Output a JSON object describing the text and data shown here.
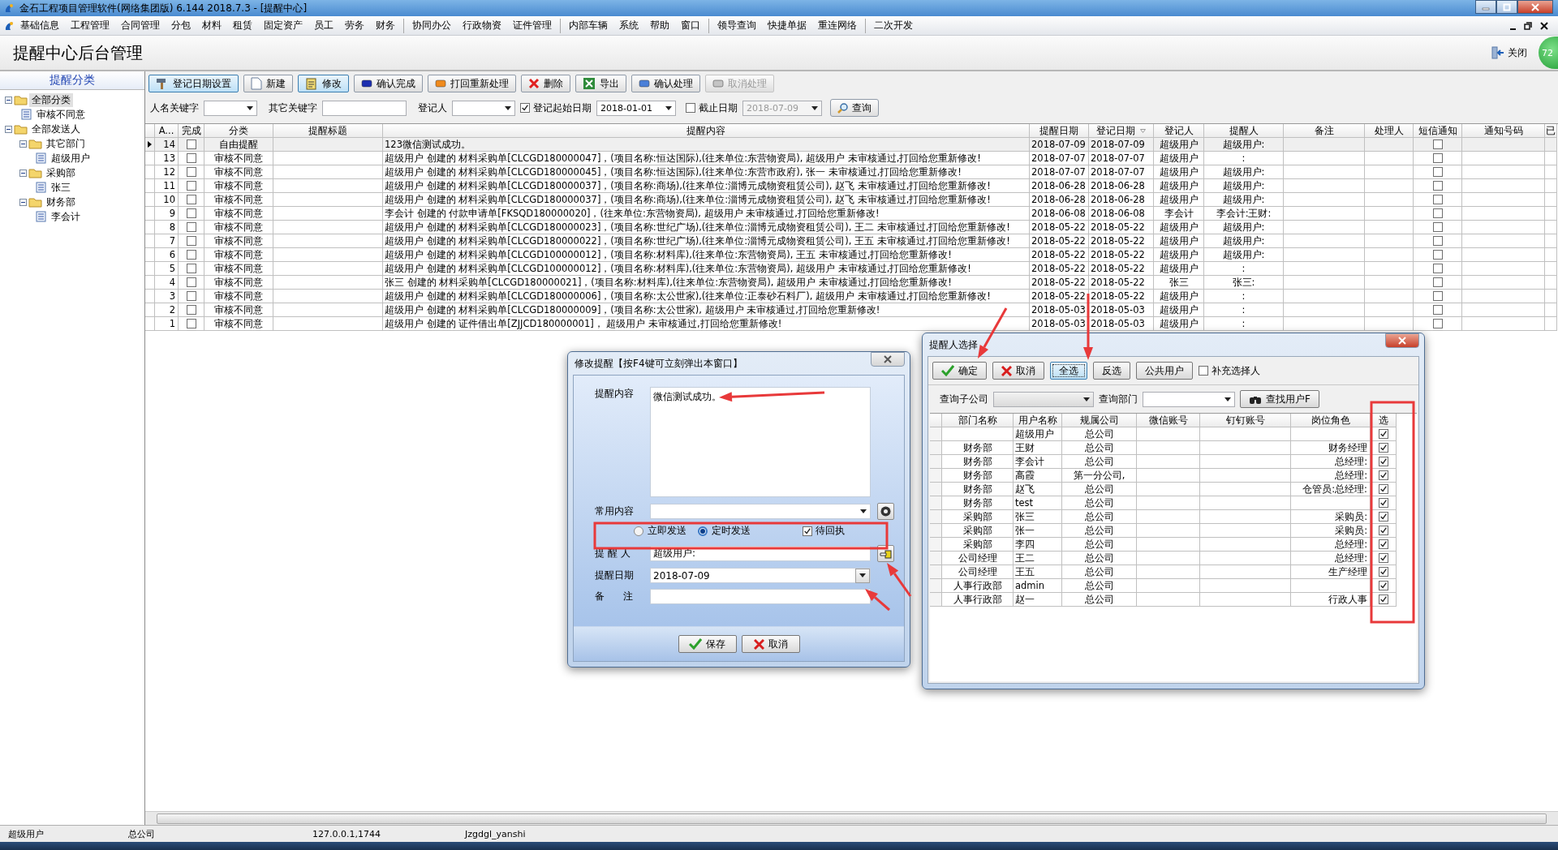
{
  "window": {
    "title": "金石工程项目管理软件(网络集团版) 6.144  2018.7.3 - [提醒中心]"
  },
  "menu_groups": [
    [
      "基础信息",
      "工程管理",
      "合同管理",
      "分包",
      "材料",
      "租赁",
      "固定资产",
      "员工",
      "劳务",
      "财务"
    ],
    [
      "协同办公",
      "行政物资",
      "证件管理"
    ],
    [
      "内部车辆",
      "系统",
      "帮助",
      "窗口"
    ],
    [
      "领导查询",
      "快捷单据",
      "重连网络"
    ],
    [
      "二次开发"
    ]
  ],
  "page": {
    "title": "提醒中心后台管理",
    "close_label": "关闭",
    "badge": "72"
  },
  "sidebar": {
    "title": "提醒分类",
    "tree": [
      {
        "label": "全部分类",
        "expanded": true,
        "selected": true,
        "children": [
          {
            "label": "审核不同意",
            "selected": false
          }
        ]
      },
      {
        "label": "全部发送人",
        "expanded": true,
        "selected": false,
        "children": [
          {
            "label": "其它部门",
            "expanded": true,
            "selected": false,
            "children": [
              {
                "label": "超级用户",
                "selected": false
              }
            ]
          },
          {
            "label": "采购部",
            "expanded": true,
            "selected": false,
            "children": [
              {
                "label": "张三",
                "selected": false
              }
            ]
          },
          {
            "label": "财务部",
            "expanded": true,
            "selected": false,
            "children": [
              {
                "label": "李会计",
                "selected": false
              }
            ]
          }
        ]
      }
    ]
  },
  "toolbar": [
    {
      "label": "登记日期设置",
      "pressed": true,
      "disabled": false
    },
    {
      "label": "新建",
      "pressed": false,
      "disabled": false
    },
    {
      "label": "修改",
      "pressed": true,
      "disabled": false
    },
    {
      "label": "确认完成",
      "pressed": false,
      "disabled": false
    },
    {
      "label": "打回重新处理",
      "pressed": false,
      "disabled": false
    },
    {
      "label": "删除",
      "pressed": false,
      "disabled": false
    },
    {
      "label": "导出",
      "pressed": false,
      "disabled": false
    },
    {
      "label": "确认处理",
      "pressed": false,
      "disabled": false
    },
    {
      "label": "取消处理",
      "pressed": false,
      "disabled": true
    }
  ],
  "filters": {
    "name_keyword": {
      "label": "人名关键字"
    },
    "other_keyword": {
      "label": "其它关键字"
    },
    "registrar": {
      "label": "登记人"
    },
    "start_date": {
      "label": "登记起始日期",
      "checked": true,
      "value": "2018-01-01"
    },
    "end_date": {
      "label": "截止日期",
      "checked": false,
      "value": "2018-07-09"
    },
    "query_button": "查询"
  },
  "table": {
    "columns": [
      {
        "label": "A...",
        "sorted": false
      },
      {
        "label": "完成",
        "sorted": false
      },
      {
        "label": "分类",
        "sorted": false
      },
      {
        "label": "提醒标题",
        "sorted": false
      },
      {
        "label": "提醒内容",
        "sorted": false
      },
      {
        "label": "提醒日期",
        "sorted": false
      },
      {
        "label": "登记日期",
        "sorted": true
      },
      {
        "label": "登记人",
        "sorted": false
      },
      {
        "label": "提醒人",
        "sorted": false
      },
      {
        "label": "备注",
        "sorted": false
      },
      {
        "label": "处理人",
        "sorted": false
      },
      {
        "label": "短信通知",
        "sorted": false
      },
      {
        "label": "通知号码",
        "sorted": false
      },
      {
        "label": "已",
        "sorted": false
      }
    ],
    "rows": [
      {
        "current": true,
        "no": "14",
        "done": false,
        "category": "自由提醒",
        "content": "123微信测试成功。",
        "remind_date": "2018-07-09",
        "register_date": "2018-07-09",
        "registrar": "超级用户",
        "reminder": "超级用户:",
        "sms": false
      },
      {
        "current": false,
        "no": "13",
        "done": false,
        "category": "审核不同意",
        "content": "超级用户 创建的 材料采购单[CLCGD180000047]，(项目名称:恒达国际),(往来单位:东营物资局), 超级用户 未审核通过,打回给您重新修改!",
        "remind_date": "2018-07-07",
        "register_date": "2018-07-07",
        "registrar": "超级用户",
        "reminder": ":",
        "sms": false
      },
      {
        "current": false,
        "no": "12",
        "done": false,
        "category": "审核不同意",
        "content": "超级用户 创建的 材料采购单[CLCGD180000045]，(项目名称:恒达国际),(往来单位:东营市政府), 张一 未审核通过,打回给您重新修改!",
        "remind_date": "2018-07-07",
        "register_date": "2018-07-07",
        "registrar": "超级用户",
        "reminder": "超级用户:",
        "sms": false
      },
      {
        "current": false,
        "no": "11",
        "done": false,
        "category": "审核不同意",
        "content": "超级用户 创建的 材料采购单[CLCGD180000037]，(项目名称:商场),(往来单位:淄博元成物资租赁公司), 赵飞 未审核通过,打回给您重新修改!",
        "remind_date": "2018-06-28",
        "register_date": "2018-06-28",
        "registrar": "超级用户",
        "reminder": "超级用户:",
        "sms": false
      },
      {
        "current": false,
        "no": "10",
        "done": false,
        "category": "审核不同意",
        "content": "超级用户 创建的 材料采购单[CLCGD180000037]，(项目名称:商场),(往来单位:淄博元成物资租赁公司), 赵飞 未审核通过,打回给您重新修改!",
        "remind_date": "2018-06-28",
        "register_date": "2018-06-28",
        "registrar": "超级用户",
        "reminder": "超级用户:",
        "sms": false
      },
      {
        "current": false,
        "no": "9",
        "done": false,
        "category": "审核不同意",
        "content": "李会计 创建的 付款申请单[FKSQD180000020]，(往来单位:东营物资局), 超级用户 未审核通过,打回给您重新修改!",
        "remind_date": "2018-06-08",
        "register_date": "2018-06-08",
        "registrar": "李会计",
        "reminder": "李会计:王财:",
        "sms": false
      },
      {
        "current": false,
        "no": "8",
        "done": false,
        "category": "审核不同意",
        "content": "超级用户 创建的 材料采购单[CLCGD180000023]，(项目名称:世纪广场),(往来单位:淄博元成物资租赁公司), 王二 未审核通过,打回给您重新修改!",
        "remind_date": "2018-05-22",
        "register_date": "2018-05-22",
        "registrar": "超级用户",
        "reminder": "超级用户:",
        "sms": false
      },
      {
        "current": false,
        "no": "7",
        "done": false,
        "category": "审核不同意",
        "content": "超级用户 创建的 材料采购单[CLCGD180000022]，(项目名称:世纪广场),(往来单位:淄博元成物资租赁公司), 王五 未审核通过,打回给您重新修改!",
        "remind_date": "2018-05-22",
        "register_date": "2018-05-22",
        "registrar": "超级用户",
        "reminder": "超级用户:",
        "sms": false
      },
      {
        "current": false,
        "no": "6",
        "done": false,
        "category": "审核不同意",
        "content": "超级用户 创建的 材料采购单[CLCGD100000012]，(项目名称:材料库),(往来单位:东营物资局), 王五 未审核通过,打回给您重新修改!",
        "remind_date": "2018-05-22",
        "register_date": "2018-05-22",
        "registrar": "超级用户",
        "reminder": "超级用户:",
        "sms": false
      },
      {
        "current": false,
        "no": "5",
        "done": false,
        "category": "审核不同意",
        "content": "超级用户 创建的 材料采购单[CLCGD100000012]，(项目名称:材料库),(往来单位:东营物资局), 超级用户 未审核通过,打回给您重新修改!",
        "remind_date": "2018-05-22",
        "register_date": "2018-05-22",
        "registrar": "超级用户",
        "reminder": ":",
        "sms": false
      },
      {
        "current": false,
        "no": "4",
        "done": false,
        "category": "审核不同意",
        "content": "张三 创建的 材料采购单[CLCGD180000021]，(项目名称:材料库),(往来单位:东营物资局), 超级用户 未审核通过,打回给您重新修改!",
        "remind_date": "2018-05-22",
        "register_date": "2018-05-22",
        "registrar": "张三",
        "reminder": "张三:",
        "sms": false
      },
      {
        "current": false,
        "no": "3",
        "done": false,
        "category": "审核不同意",
        "content": "超级用户 创建的 材料采购单[CLCGD180000006]，(项目名称:太公世家),(往来单位:正泰砂石料厂), 超级用户 未审核通过,打回给您重新修改!",
        "remind_date": "2018-05-22",
        "register_date": "2018-05-22",
        "registrar": "超级用户",
        "reminder": ":",
        "sms": false
      },
      {
        "current": false,
        "no": "2",
        "done": false,
        "category": "审核不同意",
        "content": "超级用户 创建的 材料采购单[CLCGD180000009]，(项目名称:太公世家), 超级用户 未审核通过,打回给您重新修改!",
        "remind_date": "2018-05-03",
        "register_date": "2018-05-03",
        "registrar": "超级用户",
        "reminder": ":",
        "sms": false
      },
      {
        "current": false,
        "no": "1",
        "done": false,
        "category": "审核不同意",
        "content": "超级用户 创建的 证件借出单[ZJJCD180000001]， 超级用户 未审核通过,打回给您重新修改!",
        "remind_date": "2018-05-03",
        "register_date": "2018-05-03",
        "registrar": "超级用户",
        "reminder": ":",
        "sms": false
      }
    ]
  },
  "edit_dialog": {
    "title": "修改提醒【按F4键可立刻弹出本窗口】",
    "content": {
      "label": "提醒内容",
      "value": "微信测试成功。"
    },
    "common": {
      "label": "常用内容"
    },
    "send_modes": [
      {
        "label": "立即发送",
        "selected": false
      },
      {
        "label": "定时发送",
        "selected": true
      }
    ],
    "receipt": {
      "label": "待回执",
      "checked": true
    },
    "reminder": {
      "label": "提 醒 人",
      "value": "超级用户:"
    },
    "date": {
      "label": "提醒日期",
      "value": "2018-07-09"
    },
    "note": {
      "label": "备      注"
    },
    "buttons": [
      "保存",
      "取消"
    ]
  },
  "select_dialog": {
    "title": "提醒人选择",
    "buttons": [
      {
        "label": "确定",
        "focused": false
      },
      {
        "label": "取消",
        "focused": false
      },
      {
        "label": "全选",
        "focused": true
      },
      {
        "label": "反选",
        "focused": false
      },
      {
        "label": "公共用户",
        "focused": false
      }
    ],
    "extra": {
      "label": "补充选择人",
      "checked": false
    },
    "company_label": "查询子公司",
    "dept_label": "查询部门",
    "find_button": "查找用户F",
    "columns": [
      "部门名称",
      "用户名称",
      "规属公司",
      "微信账号",
      "钉钉账号",
      "岗位角色",
      "选"
    ],
    "users": [
      {
        "user": "超级用户",
        "company": "总公司",
        "checked": true
      },
      {
        "dept": "财务部",
        "user": "王财",
        "company": "总公司",
        "role": "财务经理",
        "checked": true
      },
      {
        "dept": "财务部",
        "user": "李会计",
        "company": "总公司",
        "role": "总经理:",
        "checked": true
      },
      {
        "dept": "财务部",
        "user": "高霞",
        "company": "第一分公司,",
        "role": "总经理:",
        "checked": true
      },
      {
        "dept": "财务部",
        "user": "赵飞",
        "company": "总公司",
        "role": "仓管员:总经理:",
        "checked": true
      },
      {
        "dept": "财务部",
        "user": "test",
        "company": "总公司",
        "checked": true
      },
      {
        "dept": "采购部",
        "user": "张三",
        "company": "总公司",
        "role": "采购员:",
        "checked": true
      },
      {
        "dept": "采购部",
        "user": "张一",
        "company": "总公司",
        "role": "采购员:",
        "checked": true
      },
      {
        "dept": "采购部",
        "user": "李四",
        "company": "总公司",
        "role": "总经理:",
        "checked": true
      },
      {
        "dept": "公司经理",
        "user": "王二",
        "company": "总公司",
        "role": "总经理:",
        "checked": true
      },
      {
        "dept": "公司经理",
        "user": "王五",
        "company": "总公司",
        "role": "生产经理",
        "checked": true
      },
      {
        "dept": "人事行政部",
        "user": "admin",
        "company": "总公司",
        "checked": true
      },
      {
        "dept": "人事行政部",
        "user": "赵一",
        "company": "总公司",
        "role": "行政人事",
        "checked": true
      }
    ]
  },
  "status_bar": [
    "超级用户",
    "总公司",
    "127.0.0.1,1744",
    "Jzgdgl_yanshi"
  ]
}
